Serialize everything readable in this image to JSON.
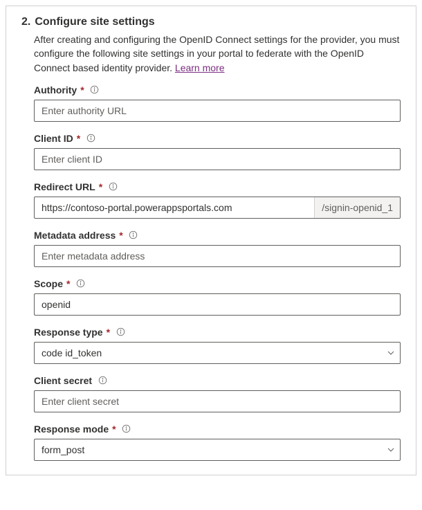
{
  "step": {
    "number": "2.",
    "title": "Configure site settings",
    "description": "After creating and configuring the OpenID Connect settings for the provider, you must configure the following site settings in your portal to federate with the OpenID Connect based identity provider. ",
    "learn_more": "Learn more"
  },
  "fields": {
    "authority": {
      "label": "Authority",
      "required": "*",
      "placeholder": "Enter authority URL",
      "value": ""
    },
    "client_id": {
      "label": "Client ID",
      "required": "*",
      "placeholder": "Enter client ID",
      "value": ""
    },
    "redirect_url": {
      "label": "Redirect URL",
      "required": "*",
      "value": "https://contoso-portal.powerappsportals.com",
      "suffix": "/signin-openid_1"
    },
    "metadata_address": {
      "label": "Metadata address",
      "required": "*",
      "placeholder": "Enter metadata address",
      "value": ""
    },
    "scope": {
      "label": "Scope",
      "required": "*",
      "value": "openid"
    },
    "response_type": {
      "label": "Response type",
      "required": "*",
      "value": "code id_token"
    },
    "client_secret": {
      "label": "Client secret",
      "placeholder": "Enter client secret",
      "value": ""
    },
    "response_mode": {
      "label": "Response mode",
      "required": "*",
      "value": "form_post"
    }
  }
}
